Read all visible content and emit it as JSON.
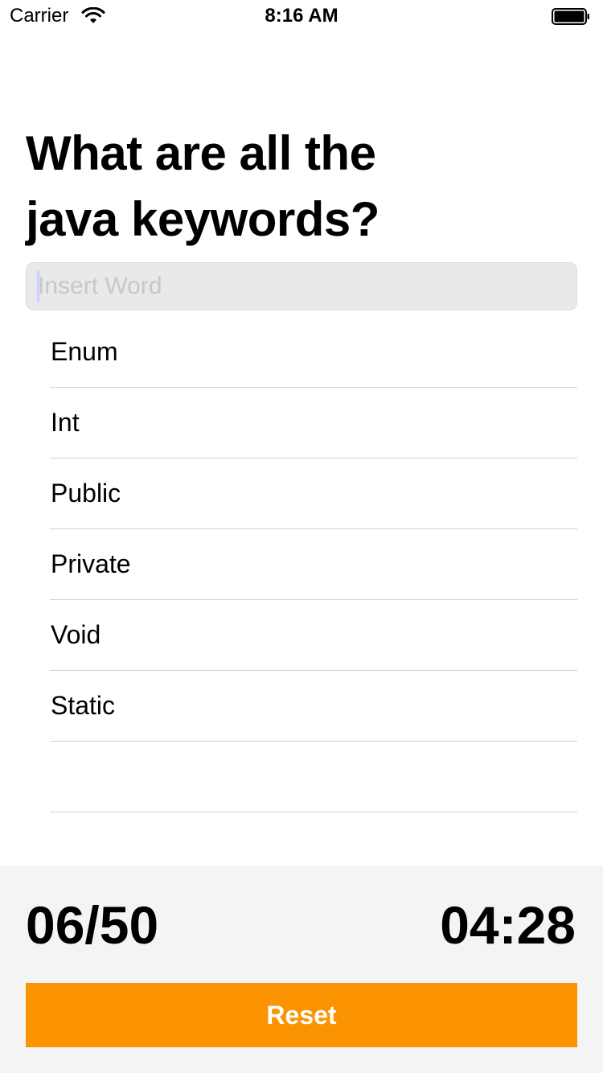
{
  "status_bar": {
    "carrier": "Carrier",
    "time": "8:16 AM",
    "wifi_icon": "wifi-icon",
    "battery_icon": "battery-icon"
  },
  "question": {
    "line1": "What are all the",
    "line2": "java keywords?"
  },
  "search": {
    "value": "",
    "placeholder": "Insert Word"
  },
  "words": [
    "Enum",
    "Int",
    "Public",
    "Private",
    "Void",
    "Static",
    ""
  ],
  "footer": {
    "score": "06/50",
    "timer": "04:28",
    "reset_label": "Reset"
  },
  "colors": {
    "accent": "#fb9400",
    "footer_bg": "#f4f4f4",
    "input_bg": "#e9e9ea"
  }
}
